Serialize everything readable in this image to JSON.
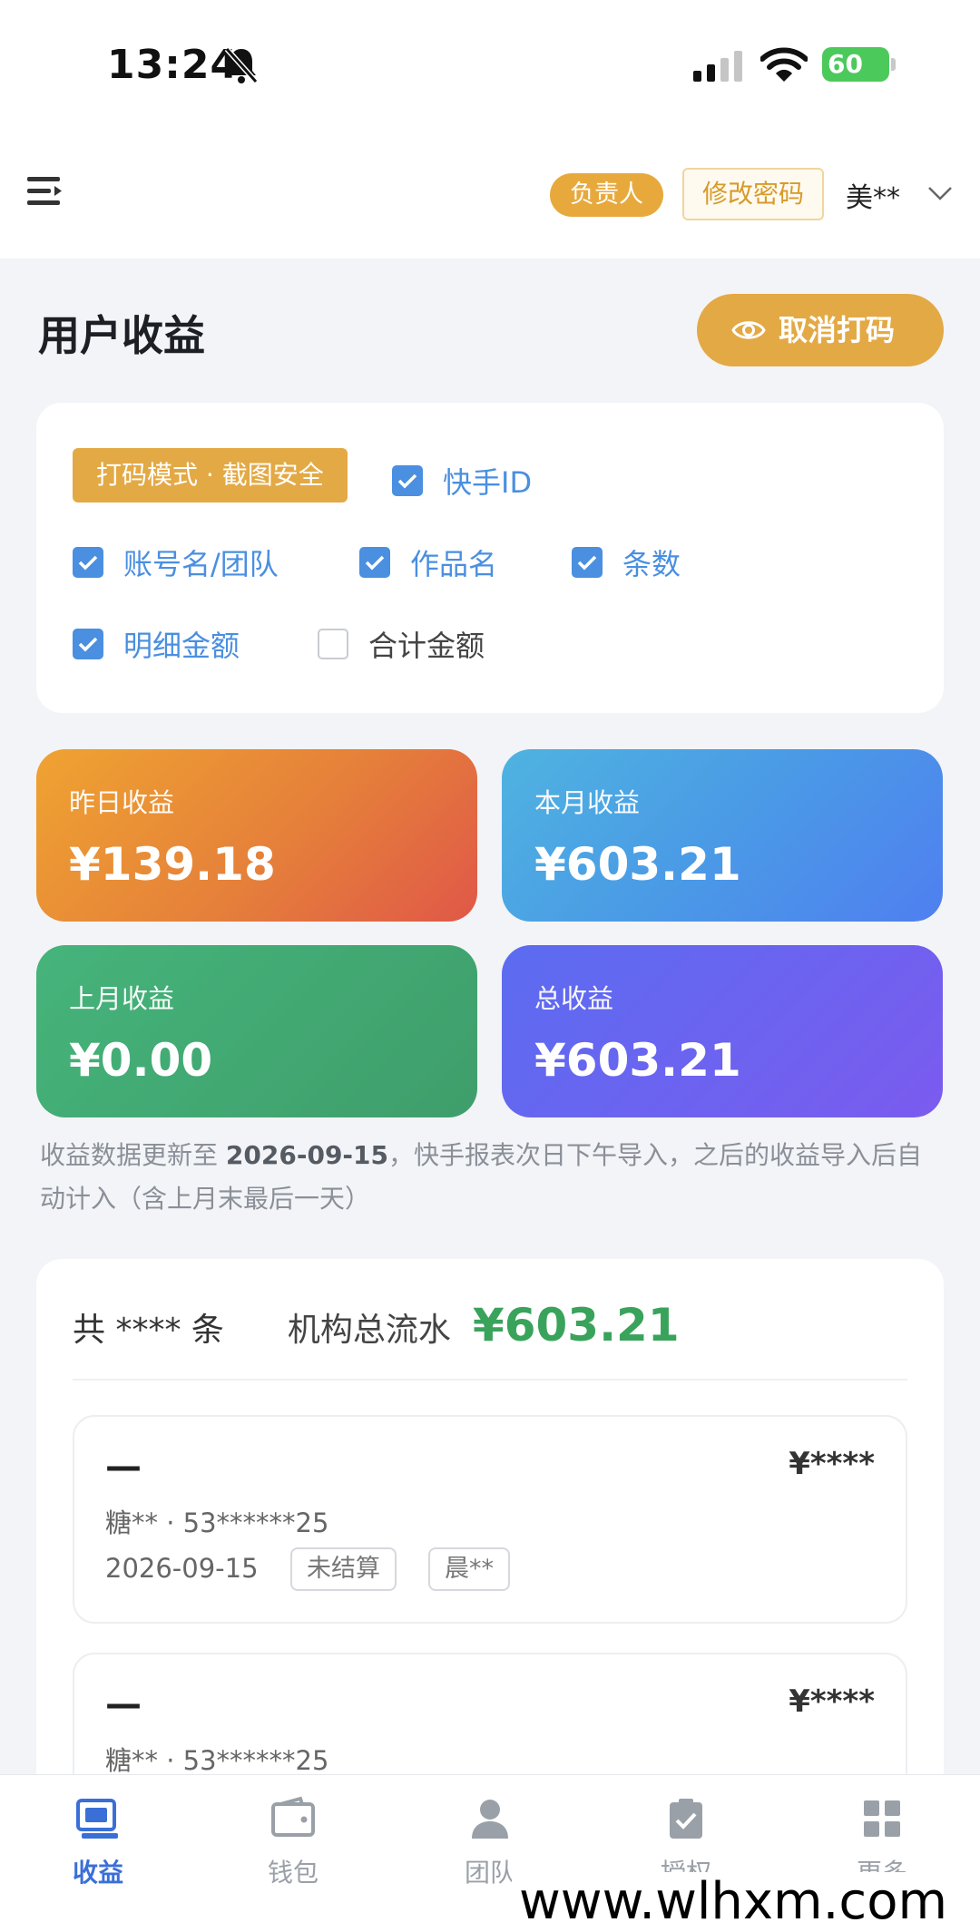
{
  "status_bar": {
    "time": "13:24",
    "battery": "60"
  },
  "header": {
    "role_badge": "负责人",
    "change_password": "修改密码",
    "user": "美**"
  },
  "page": {
    "title": "用户收益",
    "unmask_button": "取消打码"
  },
  "filters": {
    "mode_badge": "打码模式 · 截图安全",
    "options": [
      {
        "label": "快手ID",
        "checked": true
      },
      {
        "label": "账号名/团队",
        "checked": true
      },
      {
        "label": "作品名",
        "checked": true
      },
      {
        "label": "条数",
        "checked": true
      },
      {
        "label": "明细金额",
        "checked": true
      },
      {
        "label": "合计金额",
        "checked": false
      }
    ]
  },
  "stats": {
    "yesterday": {
      "label": "昨日收益",
      "value": "¥139.18"
    },
    "this_month": {
      "label": "本月收益",
      "value": "¥603.21"
    },
    "last_month": {
      "label": "上月收益",
      "value": "¥0.00"
    },
    "total": {
      "label": "总收益",
      "value": "¥603.21"
    }
  },
  "update_note": {
    "prefix": "收益数据更新至 ",
    "date": "2026-09-15",
    "suffix": "，快手报表次日下午导入，之后的收益导入后自动计入（含上月末最后一天）"
  },
  "summary": {
    "count": "共 **** 条",
    "flow_label": "机构总流水",
    "flow_value": "¥603.21"
  },
  "records": [
    {
      "title": "—",
      "amount": "¥****",
      "sub": "糖** · 53******25",
      "date": "2026-09-15",
      "status_tag": "未结算",
      "owner_tag": "晨**"
    },
    {
      "title": "—",
      "amount": "¥****",
      "sub": "糖** · 53******25"
    }
  ],
  "tabs": [
    {
      "label": "收益",
      "icon": "earnings-icon",
      "active": true
    },
    {
      "label": "钱包",
      "icon": "wallet-icon",
      "active": false
    },
    {
      "label": "团队",
      "icon": "team-icon",
      "active": false
    },
    {
      "label": "授权",
      "icon": "authorize-icon",
      "active": false
    },
    {
      "label": "更多",
      "icon": "more-grid-icon",
      "active": false
    }
  ],
  "watermark": "www.wlhxm.com",
  "colors": {
    "accent": "#e3a945",
    "check": "#4a8fe0",
    "flow": "#3aa35b",
    "tab_active": "#3a6fd8"
  }
}
